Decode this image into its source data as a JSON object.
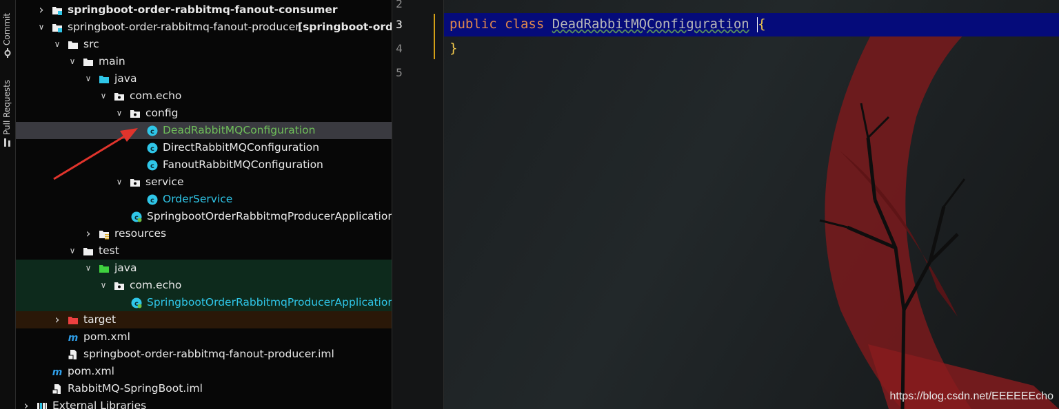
{
  "tool_strip": {
    "commit_label": "Commit",
    "pull_requests_label": "Pull Requests"
  },
  "tree": {
    "rows": [
      {
        "label": "springboot-order-rabbitmq-fanout-consumer",
        "icon": "module-folder-icon",
        "chevron": "right"
      },
      {
        "label": "springboot-order-rabbitmq-fanout-producer",
        "suffix": "[springboot-order",
        "icon": "module-folder-icon",
        "chevron": "down"
      },
      {
        "label": "src",
        "icon": "folder-icon",
        "chevron": "down"
      },
      {
        "label": "main",
        "icon": "folder-icon",
        "chevron": "down"
      },
      {
        "label": "java",
        "icon": "source-folder-icon",
        "chevron": "down"
      },
      {
        "label": "com.echo",
        "icon": "package-icon",
        "chevron": "down"
      },
      {
        "label": "config",
        "icon": "package-icon",
        "chevron": "down"
      },
      {
        "label": "DeadRabbitMQConfiguration",
        "icon": "class-icon"
      },
      {
        "label": "DirectRabbitMQConfiguration",
        "icon": "class-icon"
      },
      {
        "label": "FanoutRabbitMQConfiguration",
        "icon": "class-icon"
      },
      {
        "label": "service",
        "icon": "package-icon",
        "chevron": "down"
      },
      {
        "label": "OrderService",
        "icon": "class-icon"
      },
      {
        "label": "SpringbootOrderRabbitmqProducerApplication",
        "icon": "spring-boot-class-icon"
      },
      {
        "label": "resources",
        "icon": "resources-folder-icon",
        "chevron": "right"
      },
      {
        "label": "test",
        "icon": "folder-icon",
        "chevron": "down"
      },
      {
        "label": "java",
        "icon": "test-source-folder-icon",
        "chevron": "down"
      },
      {
        "label": "com.echo",
        "icon": "package-icon",
        "chevron": "down"
      },
      {
        "label": "SpringbootOrderRabbitmqProducerApplicationT",
        "icon": "spring-boot-class-icon"
      },
      {
        "label": "target",
        "icon": "excluded-folder-icon",
        "chevron": "right"
      },
      {
        "label": "pom.xml",
        "icon": "maven-icon"
      },
      {
        "label": "springboot-order-rabbitmq-fanout-producer.iml",
        "icon": "iml-file-icon"
      },
      {
        "label": "pom.xml",
        "icon": "maven-icon"
      },
      {
        "label": "RabbitMQ-SpringBoot.iml",
        "icon": "iml-file-icon"
      },
      {
        "label": "External Libraries",
        "icon": "libraries-icon",
        "chevron": "right"
      }
    ]
  },
  "editor": {
    "line_numbers": [
      "2",
      "3",
      "4",
      "5"
    ],
    "current_line": "3",
    "code": {
      "kw_public": "public",
      "kw_class": "class",
      "class_name": "DeadRabbitMQConfiguration",
      "open_brace": "{",
      "close_brace": "}"
    }
  },
  "watermark": "https://blog.csdn.net/EEEEEEcho",
  "colors": {
    "selection_bg": "#3a3a40",
    "current_line_bg": "#050b7a",
    "keyword": "#e0884d",
    "brace": "#f2c94c",
    "class_icon": "#2fc6e8",
    "arrow": "#e0342c"
  }
}
